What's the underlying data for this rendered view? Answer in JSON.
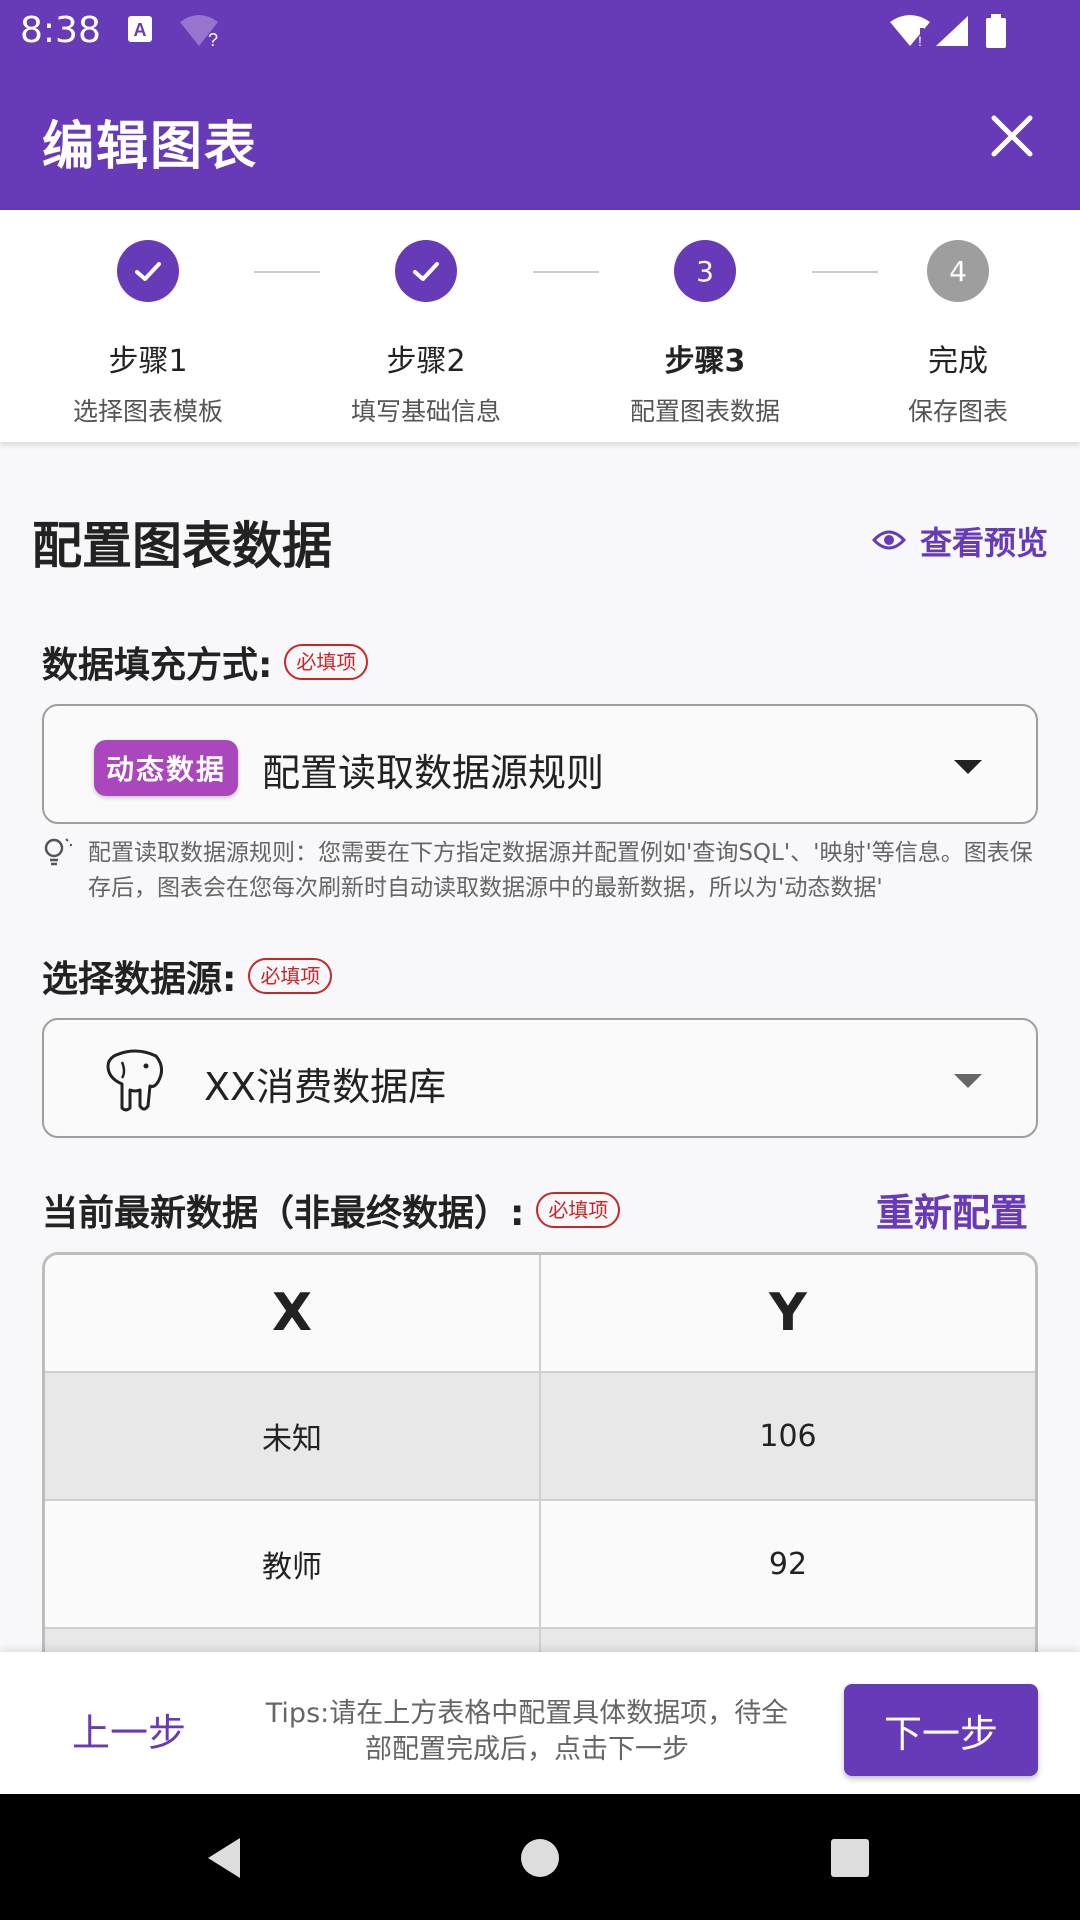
{
  "status_bar": {
    "time": "8:38",
    "icons": [
      "a-notification-icon",
      "wifi-question-icon",
      "wifi-icon",
      "signal-icon",
      "battery-icon"
    ]
  },
  "app_bar": {
    "title": "编辑图表",
    "close_icon": "close-icon"
  },
  "stepper": {
    "steps": [
      {
        "indicator": "check",
        "name": "步骤1",
        "sub": "选择图表模板",
        "state": "done"
      },
      {
        "indicator": "check",
        "name": "步骤2",
        "sub": "填写基础信息",
        "state": "done"
      },
      {
        "indicator": "3",
        "name": "步骤3",
        "sub": "配置图表数据",
        "state": "active"
      },
      {
        "indicator": "4",
        "name": "完成",
        "sub": "保存图表",
        "state": "pending"
      }
    ]
  },
  "content": {
    "section_title": "配置图表数据",
    "preview_label": "查看预览",
    "fill_method": {
      "label": "数据填充方式:",
      "required": "必填项",
      "tag": "动态数据",
      "value": "配置读取数据源规则",
      "hint": "配置读取数据源规则：您需要在下方指定数据源并配置例如'查询SQL'、'映射'等信息。图表保存后，图表会在您每次刷新时自动读取数据源中的最新数据，所以为'动态数据'"
    },
    "data_source": {
      "label": "选择数据源:",
      "required": "必填项",
      "value": "XX消费数据库",
      "icon": "postgresql-elephant-icon"
    },
    "current_data": {
      "label": "当前最新数据（非最终数据）:",
      "required": "必填项",
      "reconfigure": "重新配置",
      "columns": [
        "X",
        "Y"
      ],
      "rows": [
        [
          "未知",
          "106"
        ],
        [
          "教师",
          "92"
        ]
      ]
    }
  },
  "bottom_bar": {
    "prev_label": "上一步",
    "tips": "Tips:请在上方表格中配置具体数据项，待全部配置完成后，点击下一步",
    "next_label": "下一步"
  },
  "colors": {
    "primary": "#673ab7",
    "tag": "#ab47bc",
    "required": "#c62828",
    "pending_step": "#9e9e9e"
  }
}
